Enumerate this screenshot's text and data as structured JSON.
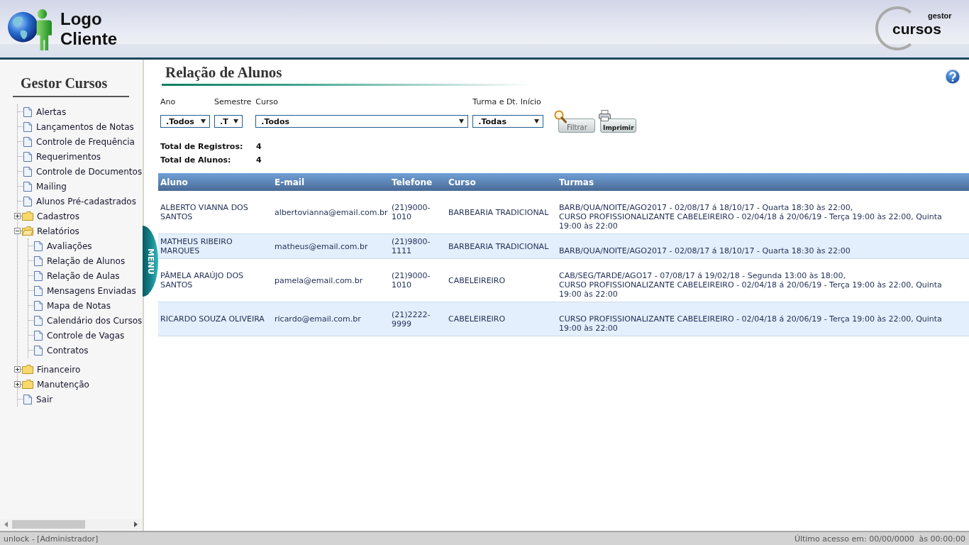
{
  "header": {
    "client_logo": [
      "Logo",
      "Cliente"
    ],
    "product_logo": {
      "small": "gestor",
      "large": "cursos"
    }
  },
  "sidebar": {
    "title": "Gestor Cursos",
    "menu_tab": "MENU",
    "items": [
      {
        "label": "Alertas",
        "kind": "page"
      },
      {
        "label": "Lançamentos de Notas",
        "kind": "page"
      },
      {
        "label": "Controle de Frequência",
        "kind": "page"
      },
      {
        "label": "Requerimentos",
        "kind": "page"
      },
      {
        "label": "Controle de Documentos",
        "kind": "page"
      },
      {
        "label": "Mailing",
        "kind": "page"
      },
      {
        "label": "Alunos Pré-cadastrados",
        "kind": "page"
      },
      {
        "label": "Cadastros",
        "kind": "folder",
        "expanded": false
      },
      {
        "label": "Relatórios",
        "kind": "folder",
        "expanded": true,
        "children": [
          {
            "label": "Avaliações",
            "kind": "page"
          },
          {
            "label": "Relação de Alunos",
            "kind": "page"
          },
          {
            "label": "Relação de Aulas",
            "kind": "page"
          },
          {
            "label": "Mensagens Enviadas",
            "kind": "page"
          },
          {
            "label": "Mapa de Notas",
            "kind": "page"
          },
          {
            "label": "Calendário dos Cursos",
            "kind": "page"
          },
          {
            "label": "Controle de Vagas",
            "kind": "page"
          },
          {
            "label": "Contratos",
            "kind": "page"
          }
        ]
      },
      {
        "label": "Financeiro",
        "kind": "folder",
        "expanded": false
      },
      {
        "label": "Manutenção",
        "kind": "folder",
        "expanded": false
      },
      {
        "label": "Sair",
        "kind": "page"
      }
    ]
  },
  "content": {
    "title": "Relação de Alunos",
    "filters": [
      {
        "label": "Ano",
        "value": ".Todos"
      },
      {
        "label": "Semestre",
        "value": ".T"
      },
      {
        "label": "Curso",
        "value": ".Todos"
      },
      {
        "label": "Turma e Dt. Início",
        "value": ".Todas"
      }
    ],
    "buttons": [
      {
        "label": "Filtrar",
        "kind": "filter"
      },
      {
        "label": "Imprimir",
        "kind": "print"
      }
    ],
    "totals": [
      {
        "label": "Total de Registros:",
        "value": "4"
      },
      {
        "label": "Total de Alunos:",
        "value": "4"
      }
    ]
  },
  "table": {
    "columns": [
      "Aluno",
      "E-mail",
      "Telefone",
      "Curso",
      "Turmas"
    ],
    "rows": [
      {
        "cells": [
          "ALBERTO VIANNA DOS SANTOS",
          "albertovianna@email.com.br",
          "(21)9000-1010",
          "BARBEARIA TRADICIONAL"
        ],
        "turmas": [
          "BARB/QUA/NOITE/AGO2017 - 02/08/17 á 18/10/17 - Quarta 18:30 às 22:00,",
          "CURSO PROFISSIONALIZANTE CABELEIREIRO - 02/04/18 á 20/06/19 - Terça 19:00 às 22:00, Quinta 19:00 às 22:00"
        ]
      },
      {
        "cells": [
          "MATHEUS RIBEIRO MARQUES",
          "matheus@email.com.br",
          "(21)9800-1111",
          "BARBEARIA TRADICIONAL"
        ],
        "turmas": [
          "BARB/QUA/NOITE/AGO2017 - 02/08/17 á 18/10/17 - Quarta 18:30 às 22:00"
        ]
      },
      {
        "cells": [
          "PÂMELA ARAÚJO DOS SANTOS",
          "pamela@email.com.br",
          "(21)9000-1010",
          "CABELEIREIRO"
        ],
        "turmas": [
          "CAB/SEG/TARDE/AGO17 - 07/08/17 á 19/02/18 - Segunda 13:00 às 18:00,",
          "CURSO PROFISSIONALIZANTE CABELEIREIRO - 02/04/18 á 20/06/19 - Terça 19:00 às 22:00, Quinta 19:00 às 22:00"
        ]
      },
      {
        "cells": [
          "RICARDO SOUZA OLIVEIRA",
          "ricardo@email.com.br",
          "(21)2222-9999",
          "CABELEIREIRO"
        ],
        "turmas": [
          "CURSO PROFISSIONALIZANTE CABELEIREIRO - 02/04/18 á 20/06/19 - Terça 19:00 às 22:00, Quinta 19:00 às 22:00"
        ]
      }
    ]
  },
  "status_bar": {
    "user": "unlock - [Administrador]",
    "last_access": "Último acesso em: 00/00/0000  às 00:00:00"
  }
}
